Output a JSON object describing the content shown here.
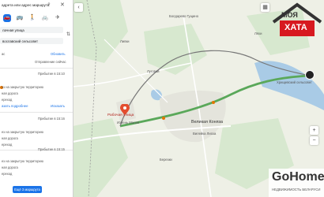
{
  "panel": {
    "search_placeholder": "адрета или адрес маршрута",
    "from_value": "лачная улица",
    "to_value": "вославский сельсовет",
    "swap_label": "",
    "option_now": "ас",
    "option_reset": "Обновить",
    "depart_label": "Отправление сейчас",
    "routes": [
      {
        "time": "Прибытие в 15:10",
        "lines": [
          "ез на закрытую территорию",
          "ная дорога",
          "ереход"
        ],
        "link_detail": "азать подробнее",
        "link_alt": "Исказать"
      },
      {
        "time": "Прибытие в 15:16",
        "lines": [
          "ез на закрытую территорию",
          "ная дорога",
          "ереход"
        ],
        "link_detail": "",
        "link_alt": ""
      },
      {
        "time": "Прибытие в 15:15",
        "lines": [
          "ез на закрытую территорию",
          "ная дорога",
          "ереход"
        ],
        "link_detail": "",
        "link_alt": ""
      }
    ],
    "add_button": "Ещё 3 маршрута"
  },
  "map": {
    "labels": {
      "l1": "Болдарево Гущино",
      "l2": "Рабочая улица",
      "l3": "Избень Малая",
      "l4": "Великая Коняза",
      "l5": "Вилейка Лиоза",
      "l6": "Луговой",
      "l7": "Хрищевский сельсовет",
      "l8": "Липки",
      "l9": "Березки",
      "l10": "Ляхи"
    },
    "route_color": "#5aa85a",
    "dest_icon": "destination-marker-icon",
    "origin_icon": "origin-marker-icon"
  },
  "branding": {
    "top_logo_text_1": "МОЯ",
    "top_logo_text_2": "ХАТА",
    "bottom_logo_text": "GoHome",
    "bottom_logo_sub": "НЕДВИЖИМОСТЬ БЕЛАРУСИ"
  },
  "colors": {
    "accent": "#1a73e8",
    "logo_red": "#d71920",
    "logo_dark": "#333333"
  }
}
